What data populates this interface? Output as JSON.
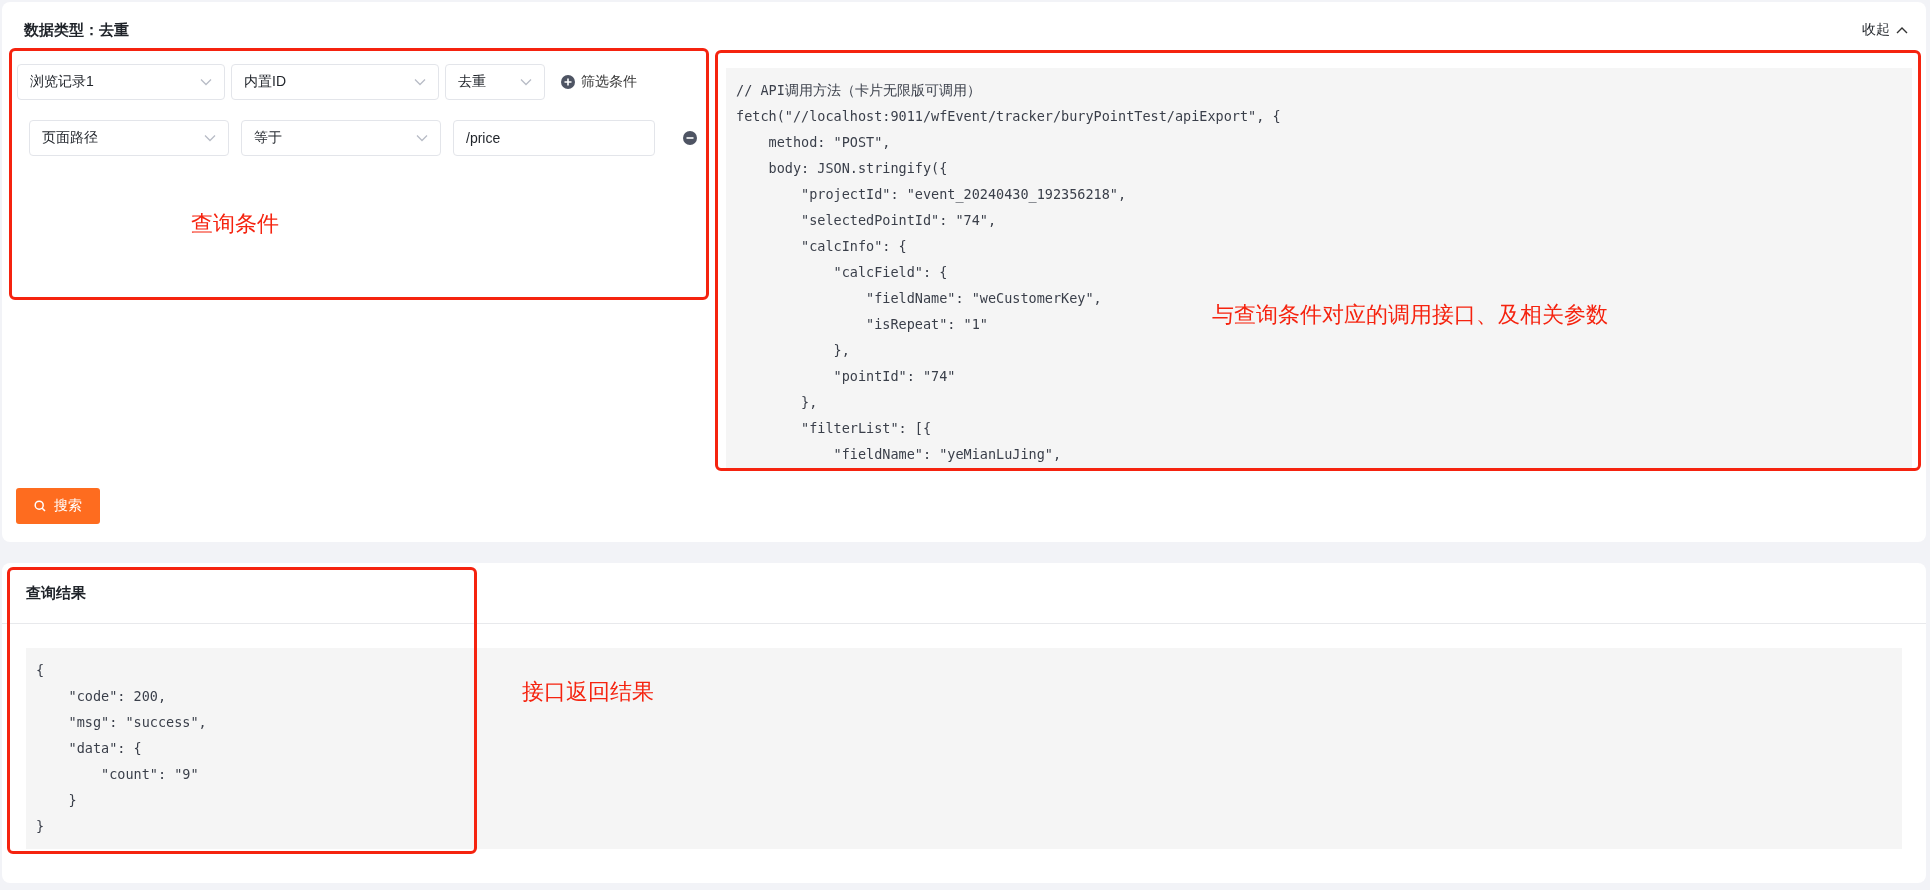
{
  "header": {
    "title": "数据类型：去重",
    "collapse_label": "收起"
  },
  "query": {
    "selects": [
      {
        "value": "浏览记录1"
      },
      {
        "value": "内置ID"
      },
      {
        "value": "去重"
      }
    ],
    "add_filter": "筛选条件",
    "filters": [
      {
        "field": "页面路径",
        "operator": "等于",
        "value": "/price"
      }
    ],
    "annotation": "查询条件",
    "search_button": "搜索"
  },
  "api_code": {
    "annotation": "与查询条件对应的调用接口、及相关参数",
    "lines": [
      "// API调用方法（卡片无限版可调用）",
      "fetch(\"//localhost:9011/wfEvent/tracker/buryPointTest/apiExport\", {",
      "    method: \"POST\",",
      "    body: JSON.stringify({",
      "        \"projectId\": \"event_20240430_192356218\",",
      "        \"selectedPointId\": \"74\",",
      "        \"calcInfo\": {",
      "            \"calcField\": {",
      "                \"fieldName\": \"weCustomerKey\",",
      "                \"isRepeat\": \"1\"",
      "            },",
      "            \"pointId\": \"74\"",
      "        },",
      "        \"filterList\": [{",
      "            \"fieldName\": \"yeMianLuJing\","
    ]
  },
  "result": {
    "title": "查询结果",
    "annotation": "接口返回结果",
    "lines": [
      "{",
      "    \"code\": 200,",
      "    \"msg\": \"success\",",
      "    \"data\": {",
      "        \"count\": \"9\"",
      "    }",
      "}"
    ]
  }
}
